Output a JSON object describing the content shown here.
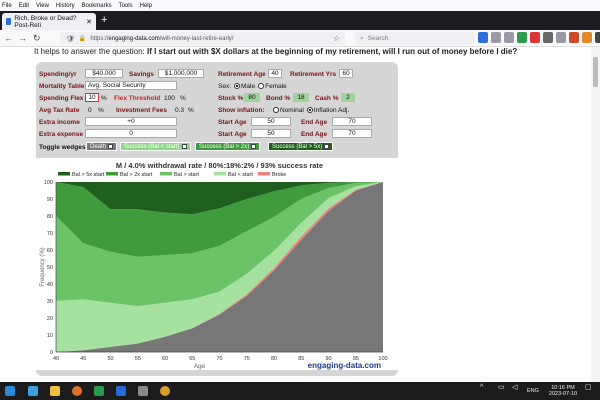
{
  "browser": {
    "menu": [
      "File",
      "Edit",
      "View",
      "History",
      "Bookmarks",
      "Tools",
      "Help"
    ],
    "tab_title": "Rich, Broke or Dead? Post-Reti",
    "url_prefix": "https://",
    "url_domain": "engaging-data.com",
    "url_path": "/will-money-last-retire-early/",
    "search_placeholder": "Search"
  },
  "page": {
    "question_prefix": "It helps to answer the question: ",
    "question_bold": "If I start out with $X dollars at the beginning of my retirement, will I run out of money before I die?"
  },
  "form": {
    "spending_label": "Spending/yr",
    "spending_value": "$40,000",
    "savings_label": "Savings",
    "savings_value": "$1,000,000",
    "retire_age_label": "Retirement Age",
    "retire_age_value": "40",
    "retire_yrs_label": "Retirement Yrs",
    "retire_yrs_value": "60",
    "mortality_label": "Mortality Table:",
    "mortality_value": "Avg. Social Security",
    "sex_label": "Sex:",
    "sex_male": "Male",
    "sex_female": "Female",
    "flex_label": "Spending Flex",
    "flex_value": "10",
    "pct": "%",
    "threshold_label": "Flex Threshold",
    "threshold_value": "100",
    "stock_label": "Stock %",
    "stock_value": "80",
    "bond_label": "Bond %",
    "bond_value": "18",
    "cash_label": "Cash %",
    "cash_value": "2",
    "tax_label": "Avg Tax Rate",
    "tax_value": "0",
    "fees_label": "Investment Fees",
    "fees_value": "0.3",
    "inflation_label": "Show inflation:",
    "inflation_nominal": "Nominal",
    "inflation_adj": "Inflation Adj.",
    "extra_income_label": "Extra income",
    "extra_income_value": "+0",
    "extra_expense_label": "Extra expense",
    "extra_expense_value": "0",
    "start_age_label": "Start Age",
    "end_age_label": "End Age",
    "start_age_1": "50",
    "end_age_1": "70",
    "start_age_2": "50",
    "end_age_2": "70",
    "toggle_label": "Toggle wedges:",
    "wedges": [
      "Death",
      "Success (Bal < start)",
      "Success (Bal > 2x)",
      "Success (Bal > 5x)"
    ],
    "wedge_colors": [
      "#777777",
      "#90d68a",
      "#3f9b3b",
      "#1f5e1c"
    ]
  },
  "chart_data": {
    "type": "area",
    "title": "M / 4.0% withdrawal rate / 80%:18%:2% / 93% success rate",
    "xlabel": "Age",
    "ylabel": "Frequency (%)",
    "xlim": [
      40,
      100
    ],
    "ylim": [
      0,
      100
    ],
    "x_ticks": [
      40,
      45,
      50,
      55,
      60,
      65,
      70,
      75,
      80,
      85,
      90,
      95,
      100
    ],
    "y_ticks": [
      0,
      10,
      20,
      30,
      40,
      50,
      60,
      70,
      80,
      90,
      100
    ],
    "legend": [
      "Bal > 5x start",
      "Bal > 2x start",
      "Bal > start",
      "Bal < start",
      "Broke"
    ],
    "legend_colors": [
      "#1f5e1c",
      "#3f9b3b",
      "#6cc266",
      "#a6e29f",
      "#f08080"
    ],
    "watermark": "engaging-data.com",
    "x": [
      40,
      45,
      50,
      55,
      60,
      65,
      70,
      75,
      80,
      85,
      90,
      95,
      100
    ],
    "series": [
      {
        "name": "Death",
        "values": [
          0,
          1,
          3,
          5,
          9,
          14,
          22,
          33,
          48,
          66,
          83,
          95,
          100
        ]
      },
      {
        "name": "Broke",
        "values": [
          0,
          0,
          0,
          0,
          0,
          0,
          0.5,
          1,
          1.5,
          2,
          1.5,
          0.5,
          0
        ]
      },
      {
        "name": "Bal < start",
        "values": [
          30,
          30,
          26,
          22,
          20,
          17,
          13,
          12,
          10,
          8,
          6,
          2,
          0
        ]
      },
      {
        "name": "Bal > start",
        "values": [
          50,
          33,
          30,
          29,
          28,
          27,
          27,
          25,
          20,
          14,
          6,
          2,
          0
        ]
      },
      {
        "name": "Bal > 2x start",
        "values": [
          20,
          33,
          25,
          28,
          25,
          23,
          22,
          19,
          15,
          8,
          3,
          0.5,
          0
        ]
      },
      {
        "name": "Bal > 5x start",
        "values": [
          0,
          3,
          16,
          16,
          18,
          19,
          15.5,
          10,
          5.5,
          2,
          0.5,
          0,
          0
        ]
      }
    ]
  },
  "taskbar": {
    "lang": "ENG",
    "time": "10:16 PM",
    "date": "2023-07-10"
  }
}
